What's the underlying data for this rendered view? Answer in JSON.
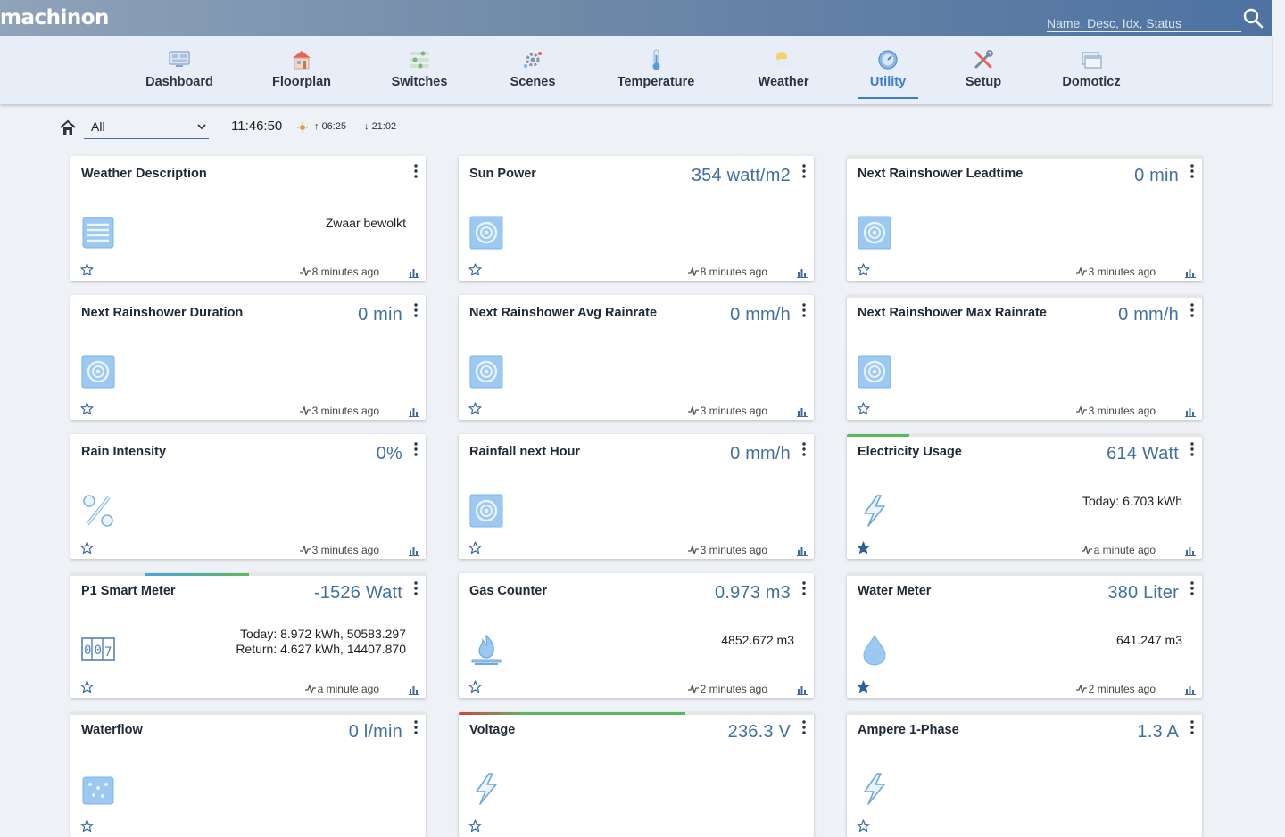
{
  "header": {
    "logo": "machinon",
    "search_placeholder": "Name, Desc, Idx, Status"
  },
  "nav": {
    "items": [
      {
        "label": "Dashboard",
        "icon": "monitor-icon"
      },
      {
        "label": "Floorplan",
        "icon": "house-icon"
      },
      {
        "label": "Switches",
        "icon": "switches-icon"
      },
      {
        "label": "Scenes",
        "icon": "scenes-icon"
      },
      {
        "label": "Temperature",
        "icon": "thermometer-icon"
      },
      {
        "label": "Weather",
        "icon": "cloud-sun-icon"
      },
      {
        "label": "Utility",
        "icon": "gauge-icon"
      },
      {
        "label": "Setup",
        "icon": "tools-icon"
      },
      {
        "label": "Domoticz",
        "icon": "windows-icon"
      }
    ],
    "active": "Utility"
  },
  "toolbar": {
    "room": "All",
    "time": "11:46:50",
    "sunrise": "06:25",
    "sunset": "21:02"
  },
  "colors": {
    "accent": "#3b7bd0",
    "value": "#3f6fa3",
    "icon_fill": "#9cc9f2",
    "green_bar": "#5cb85c",
    "blue_bar": "#4aa3df",
    "red_bar": "#c9473b"
  },
  "cards": [
    {
      "title": "Weather Description",
      "value": "",
      "detail": "Zwaar bewolkt",
      "detail2": "",
      "updated": "8 minutes ago",
      "icon": "text-icon",
      "favorite": false
    },
    {
      "title": "Sun Power",
      "value": "354 watt/m2",
      "detail": "",
      "detail2": "",
      "updated": "8 minutes ago",
      "icon": "custom-sensor-icon",
      "favorite": false
    },
    {
      "title": "Next Rainshower Leadtime",
      "value": "0 min",
      "detail": "",
      "detail2": "",
      "updated": "3 minutes ago",
      "icon": "custom-sensor-icon",
      "favorite": false
    },
    {
      "title": "Next Rainshower Duration",
      "value": "0 min",
      "detail": "",
      "detail2": "",
      "updated": "3 minutes ago",
      "icon": "custom-sensor-icon",
      "favorite": false
    },
    {
      "title": "Next Rainshower Avg Rainrate",
      "value": "0 mm/h",
      "detail": "",
      "detail2": "",
      "updated": "3 minutes ago",
      "icon": "custom-sensor-icon",
      "favorite": false
    },
    {
      "title": "Next Rainshower Max Rainrate",
      "value": "0 mm/h",
      "detail": "",
      "detail2": "",
      "updated": "3 minutes ago",
      "icon": "custom-sensor-icon",
      "favorite": false
    },
    {
      "title": "Rain Intensity",
      "value": "0%",
      "detail": "",
      "detail2": "",
      "updated": "3 minutes ago",
      "icon": "percent-icon",
      "favorite": false
    },
    {
      "title": "Rainfall next Hour",
      "value": "0 mm/h",
      "detail": "",
      "detail2": "",
      "updated": "3 minutes ago",
      "icon": "custom-sensor-icon",
      "favorite": false
    },
    {
      "title": "Electricity Usage",
      "value": "614 Watt",
      "detail": "Today: 6.703 kWh",
      "detail2": "",
      "updated": "a minute ago",
      "icon": "lightning-icon",
      "favorite": true
    },
    {
      "title": "P1 Smart Meter",
      "value": "-1526 Watt",
      "detail": "Today: 8.972 kWh, 50583.297",
      "detail2": "Return: 4.627 kWh, 14407.870",
      "updated": "a minute ago",
      "icon": "counter-icon",
      "favorite": false
    },
    {
      "title": "Gas Counter",
      "value": "0.973 m3",
      "detail": "4852.672 m3",
      "detail2": "",
      "updated": "2 minutes ago",
      "icon": "gas-flame-icon",
      "favorite": false
    },
    {
      "title": "Water Meter",
      "value": "380 Liter",
      "detail": "641.247 m3",
      "detail2": "",
      "updated": "2 minutes ago",
      "icon": "water-drop-icon",
      "favorite": true
    },
    {
      "title": "Waterflow",
      "value": "0 l/min",
      "detail": "",
      "detail2": "",
      "updated": "",
      "icon": "waterflow-icon",
      "favorite": false
    },
    {
      "title": "Voltage",
      "value": "236.3 V",
      "detail": "",
      "detail2": "",
      "updated": "",
      "icon": "lightning-icon",
      "favorite": false
    },
    {
      "title": "Ampere 1-Phase",
      "value": "1.3 A",
      "detail": "",
      "detail2": "",
      "updated": "",
      "icon": "lightning-icon",
      "favorite": false
    }
  ]
}
